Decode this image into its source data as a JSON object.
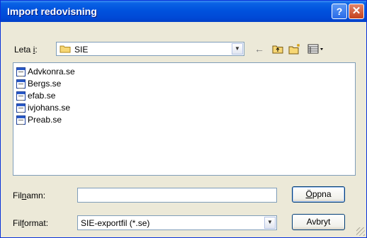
{
  "window": {
    "title": "Import redovisning"
  },
  "title_buttons": {
    "help": "?",
    "close": "✕"
  },
  "lookin": {
    "label_pre": "Leta ",
    "label_u": "i",
    "label_post": ":",
    "value": "SIE"
  },
  "toolbar": {
    "back": "←",
    "up": "⬑",
    "new_folder": "✱",
    "view": "☷"
  },
  "files": [
    "Advkonra.se",
    "Bergs.se",
    "efab.se",
    "ivjohans.se",
    "Preab.se"
  ],
  "filename": {
    "label_pre": "Fil",
    "label_u": "n",
    "label_post": "amn:",
    "value": ""
  },
  "filetype": {
    "label_pre": "Fil",
    "label_u": "f",
    "label_post": "ormat:",
    "value": "SIE-exportfil (*.se)"
  },
  "buttons": {
    "open_u": "Ö",
    "open_rest": "ppna",
    "cancel": "Avbryt"
  }
}
